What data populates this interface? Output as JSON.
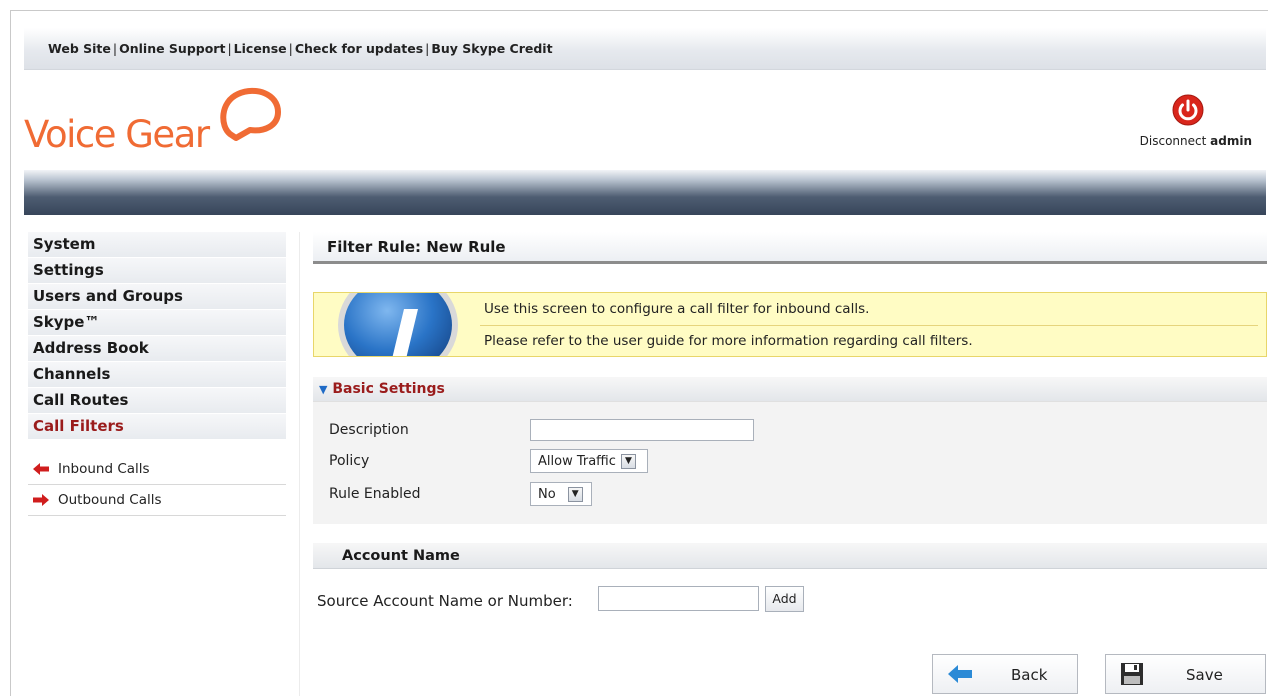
{
  "top_links": [
    "Web Site",
    "Online Support",
    "License",
    "Check for updates",
    "Buy Skype Credit"
  ],
  "brand": {
    "logo_text": "Voice Gear",
    "accent": "#f06b34"
  },
  "session": {
    "disconnect_label": "Disconnect",
    "user": "admin",
    "icon": "power-icon"
  },
  "sidebar": {
    "menu": [
      {
        "label": "System"
      },
      {
        "label": "Settings"
      },
      {
        "label": "Users and Groups"
      },
      {
        "label": "Skype™"
      },
      {
        "label": "Address Book"
      },
      {
        "label": "Channels"
      },
      {
        "label": "Call Routes"
      },
      {
        "label": "Call Filters",
        "active": true
      }
    ],
    "submenu": [
      {
        "label": "Inbound Calls",
        "icon": "arrow-left-icon"
      },
      {
        "label": "Outbound Calls",
        "icon": "arrow-right-icon"
      }
    ]
  },
  "page": {
    "title": "Filter Rule: New Rule",
    "info_lines": [
      "Use this screen to configure a call filter for inbound calls.",
      "Please refer to the user guide for more information regarding call filters."
    ]
  },
  "basic_settings": {
    "title": "Basic Settings",
    "description_label": "Description",
    "description_value": "",
    "policy_label": "Policy",
    "policy_value": "Allow Traffic",
    "enabled_label": "Rule Enabled",
    "enabled_value": "No"
  },
  "account": {
    "title": "Account Name",
    "source_label": "Source Account Name or Number:",
    "source_value": "",
    "add_label": "Add"
  },
  "actions": {
    "back_label": "Back",
    "save_label": "Save"
  },
  "colors": {
    "active_menu": "#9a1c1c",
    "info_bg": "#fffcc4",
    "link_blue": "#1f6bc6"
  }
}
